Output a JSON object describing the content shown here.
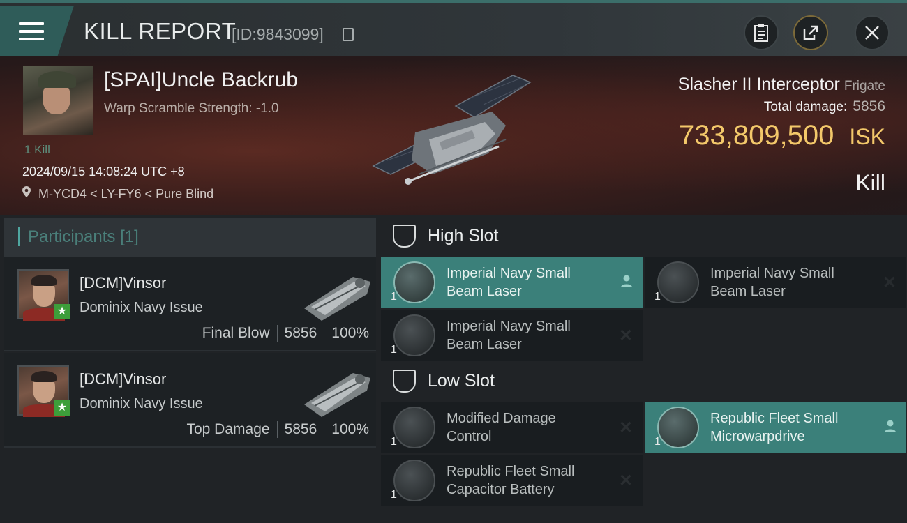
{
  "header": {
    "title": "KILL REPORT",
    "report_id": "[ID:9843099]"
  },
  "victim": {
    "name": "[SPAI]Uncle Backrub",
    "scramble": "Warp Scramble Strength: -1.0",
    "kill_count": "1 Kill",
    "timestamp": "2024/09/15 14:08:24 UTC +8",
    "location": "M-YCD4 < LY-FY6 < Pure Blind",
    "ship": "Slasher II Interceptor",
    "ship_class": "Frigate",
    "total_damage_label": "Total damage:",
    "total_damage": "5856",
    "isk_value": "733,809,500",
    "isk_unit": "ISK",
    "result": "Kill"
  },
  "participants": {
    "title": "Participants",
    "count": "[1]",
    "rows": [
      {
        "name": "[DCM]Vinsor",
        "ship": "Dominix Navy Issue",
        "role": "Final Blow",
        "damage": "5856",
        "percent": "100%"
      },
      {
        "name": "[DCM]Vinsor",
        "ship": "Dominix Navy Issue",
        "role": "Top Damage",
        "damage": "5856",
        "percent": "100%"
      }
    ]
  },
  "slots": {
    "high": {
      "title": "High Slot",
      "modules": [
        {
          "name_l1": "Imperial Navy Small",
          "name_l2": "Beam Laser",
          "qty": "1",
          "state": "active",
          "marker": "person-icon"
        },
        {
          "name_l1": "Imperial Navy Small",
          "name_l2": "Beam Laser",
          "qty": "1",
          "state": "destroyed",
          "marker": "x-icon"
        },
        {
          "name_l1": "Imperial Navy Small",
          "name_l2": "Beam Laser",
          "qty": "1",
          "state": "destroyed",
          "marker": "x-icon"
        }
      ]
    },
    "low": {
      "title": "Low Slot",
      "modules": [
        {
          "name_l1": "Modified Damage",
          "name_l2": "Control",
          "qty": "1",
          "state": "destroyed",
          "marker": "x-icon"
        },
        {
          "name_l1": "Republic Fleet Small",
          "name_l2": "Microwarpdrive",
          "qty": "1",
          "state": "active",
          "marker": "person-icon"
        },
        {
          "name_l1": "Republic Fleet Small",
          "name_l2": "Capacitor Battery",
          "qty": "1",
          "state": "destroyed",
          "marker": "x-icon"
        }
      ]
    }
  },
  "colors": {
    "accent_teal": "#3b807a",
    "isk_gold": "#f3c86a",
    "star_green": "#3d9e3a"
  }
}
